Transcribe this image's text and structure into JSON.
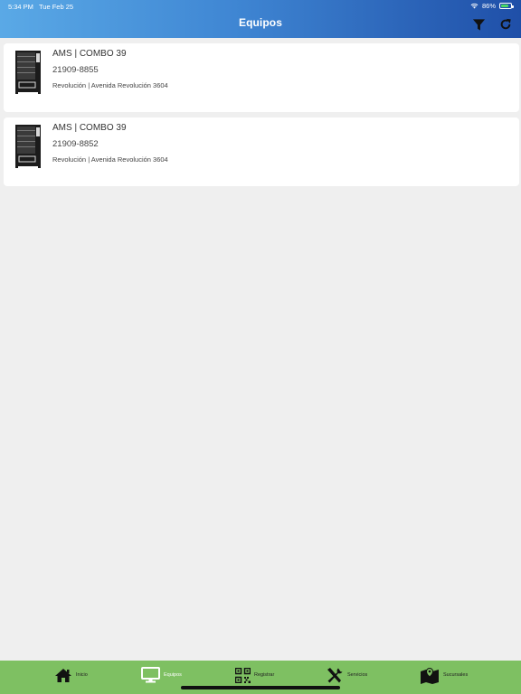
{
  "status": {
    "time": "5:34 PM",
    "date": "Tue Feb 25",
    "battery": "86%"
  },
  "header": {
    "title": "Equipos",
    "filter_icon": "filter-icon",
    "refresh_icon": "refresh-icon"
  },
  "equipment": [
    {
      "title": "AMS  |  COMBO 39",
      "serial": "21909-8855",
      "location": "Revolución | Avenida Revolución 3604",
      "icon": "vending-machine-icon"
    },
    {
      "title": "AMS  |  COMBO 39",
      "serial": "21909-8852",
      "location": "Revolución | Avenida Revolución 3604",
      "icon": "vending-machine-icon"
    }
  ],
  "tabs": [
    {
      "label": "Inicio",
      "icon": "home-icon"
    },
    {
      "label": "Equipos",
      "icon": "monitor-icon",
      "active": true
    },
    {
      "label": "Registrar",
      "icon": "qr-code-icon"
    },
    {
      "label": "Servicios",
      "icon": "tools-icon"
    },
    {
      "label": "Sucursales",
      "icon": "map-pin-icon"
    }
  ],
  "colors": {
    "header_start": "#5aa9e6",
    "header_end": "#1f4fa8",
    "tabbar": "#7ec062",
    "background": "#efefef"
  }
}
